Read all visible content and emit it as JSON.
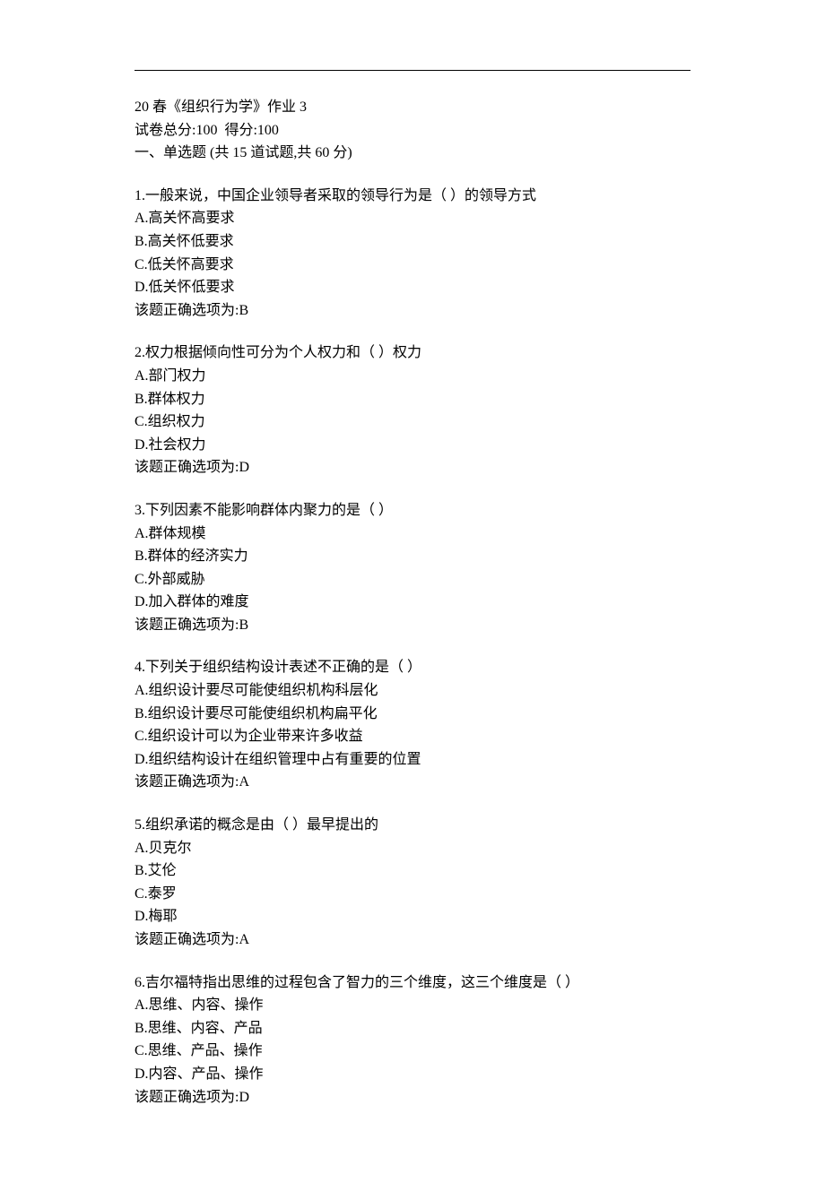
{
  "header": {
    "title": "20 春《组织行为学》作业 3",
    "score_line": "试卷总分:100  得分:100",
    "section_line": "一、单选题 (共 15 道试题,共 60 分)"
  },
  "questions": [
    {
      "stem": "1.一般来说，中国企业领导者采取的领导行为是（ ）的领导方式",
      "options": [
        "A.高关怀高要求",
        "B.高关怀低要求",
        "C.低关怀高要求",
        "D.低关怀低要求"
      ],
      "answer": "该题正确选项为:B"
    },
    {
      "stem": "2.权力根据倾向性可分为个人权力和（ ）权力",
      "options": [
        "A.部门权力",
        "B.群体权力",
        "C.组织权力",
        "D.社会权力"
      ],
      "answer": "该题正确选项为:D"
    },
    {
      "stem": "3.下列因素不能影响群体内聚力的是（ ）",
      "options": [
        "A.群体规模",
        "B.群体的经济实力",
        "C.外部威胁",
        "D.加入群体的难度"
      ],
      "answer": "该题正确选项为:B"
    },
    {
      "stem": "4.下列关于组织结构设计表述不正确的是（ ）",
      "options": [
        "A.组织设计要尽可能使组织机构科层化",
        "B.组织设计要尽可能使组织机构扁平化",
        "C.组织设计可以为企业带来许多收益",
        "D.组织结构设计在组织管理中占有重要的位置"
      ],
      "answer": "该题正确选项为:A"
    },
    {
      "stem": "5.组织承诺的概念是由（ ）最早提出的",
      "options": [
        "A.贝克尔",
        "B.艾伦",
        "C.泰罗",
        "D.梅耶"
      ],
      "answer": "该题正确选项为:A"
    },
    {
      "stem": "6.吉尔福特指出思维的过程包含了智力的三个维度，这三个维度是（ ）",
      "options": [
        "A.思维、内容、操作",
        "B.思维、内容、产品",
        "C.思维、产品、操作",
        "D.内容、产品、操作"
      ],
      "answer": "该题正确选项为:D"
    }
  ]
}
